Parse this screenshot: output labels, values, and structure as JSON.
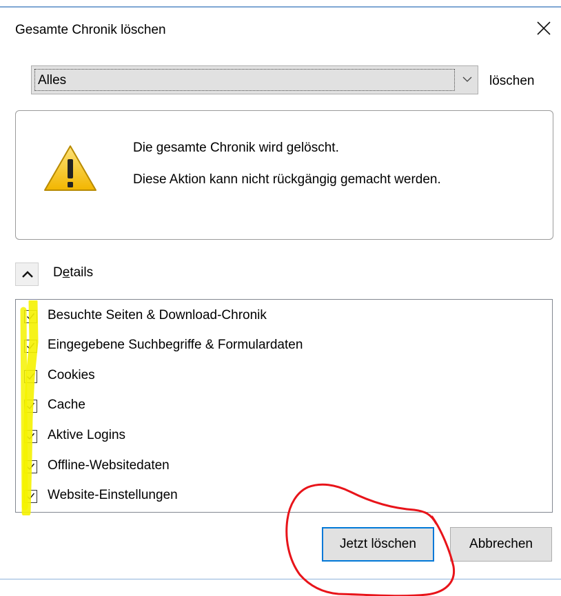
{
  "dialog": {
    "title": "Gesamte Chronik löschen",
    "close_icon": "close-icon"
  },
  "time_range": {
    "selected": "Alles",
    "action_label": "löschen"
  },
  "warning": {
    "icon": "warning-triangle-icon",
    "line1": "Die gesamte Chronik wird gelöscht.",
    "line2": "Diese Aktion kann nicht rückgängig gemacht werden."
  },
  "details": {
    "toggle_icon": "chevron-up-icon",
    "label_prefix": "D",
    "label_underlined": "e",
    "label_suffix": "tails",
    "expanded": true
  },
  "items": [
    {
      "label": "Besuchte Seiten & Download-Chronik",
      "checked": true
    },
    {
      "label": "Eingegebene Suchbegriffe & Formulardaten",
      "checked": true
    },
    {
      "label": "Cookies",
      "checked": true
    },
    {
      "label": "Cache",
      "checked": true
    },
    {
      "label": "Aktive Logins",
      "checked": true
    },
    {
      "label": "Offline-Websitedaten",
      "checked": true
    },
    {
      "label": "Website-Einstellungen",
      "checked": true
    }
  ],
  "buttons": {
    "confirm": "Jetzt löschen",
    "cancel": "Abbrechen"
  },
  "colors": {
    "accent": "#0078d7",
    "highlight": "#f5f200",
    "annotation": "#e8141a",
    "warning": "#f6c21c"
  }
}
